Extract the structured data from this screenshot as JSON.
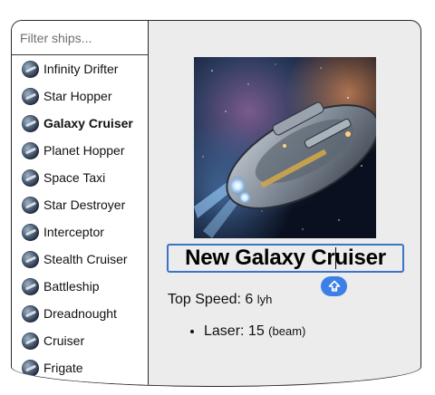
{
  "filter": {
    "placeholder": "Filter ships..."
  },
  "ships": [
    {
      "name": "Infinity Drifter",
      "active": false
    },
    {
      "name": "Star Hopper",
      "active": false
    },
    {
      "name": "Galaxy Cruiser",
      "active": true
    },
    {
      "name": "Planet Hopper",
      "active": false
    },
    {
      "name": "Space Taxi",
      "active": false
    },
    {
      "name": "Star Destroyer",
      "active": false
    },
    {
      "name": "Interceptor",
      "active": false
    },
    {
      "name": "Stealth Cruiser",
      "active": false
    },
    {
      "name": "Battleship",
      "active": false
    },
    {
      "name": "Dreadnought",
      "active": false
    },
    {
      "name": "Cruiser",
      "active": false
    },
    {
      "name": "Frigate",
      "active": false
    }
  ],
  "detail": {
    "name_value": "New Galaxy Cruiser",
    "speed_label": "Top Speed: ",
    "speed_value": "6",
    "speed_unit": "lyh",
    "weapons": [
      {
        "label": "Laser: ",
        "value": "15",
        "unit": "(beam)"
      }
    ],
    "image_icon": "spaceship-image",
    "fab_icon": "shift-arrow-icon"
  },
  "colors": {
    "accent": "#3d7fe6",
    "focus_border": "#3b73c8",
    "panel_bg": "#ececec"
  }
}
